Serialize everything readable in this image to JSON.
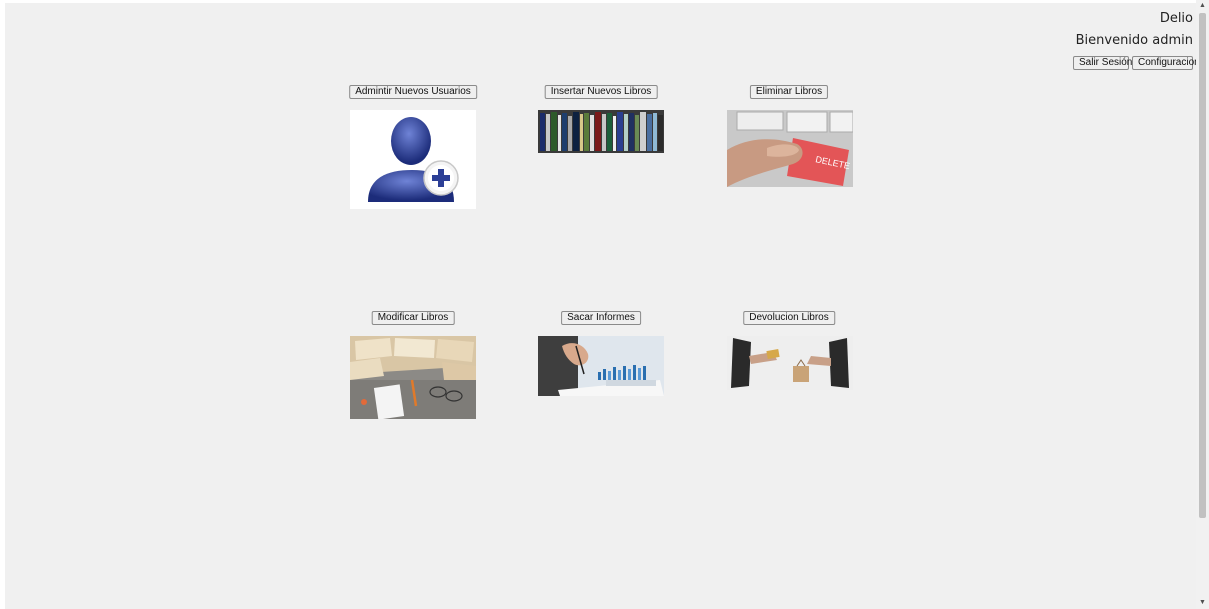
{
  "header": {
    "user_name": "Delio",
    "welcome": "Bienvenido admin",
    "logout_label": "Salir Sesión",
    "settings_label": "Configuracion"
  },
  "cards": [
    {
      "label": "Admintir Nuevos Usuarios",
      "image": "user-add-icon"
    },
    {
      "label": "Insertar Nuevos Libros",
      "image": "bookshelf-image"
    },
    {
      "label": "Eliminar Libros",
      "image": "delete-key-image"
    },
    {
      "label": "Modificar Libros",
      "image": "open-books-image"
    },
    {
      "label": "Sacar Informes",
      "image": "report-writing-image"
    },
    {
      "label": "Devolucion Libros",
      "image": "book-exchange-image"
    }
  ],
  "colors": {
    "background": "#f0f0f0",
    "delete_key": "#e35557",
    "user_icon": "#2c3f96"
  }
}
